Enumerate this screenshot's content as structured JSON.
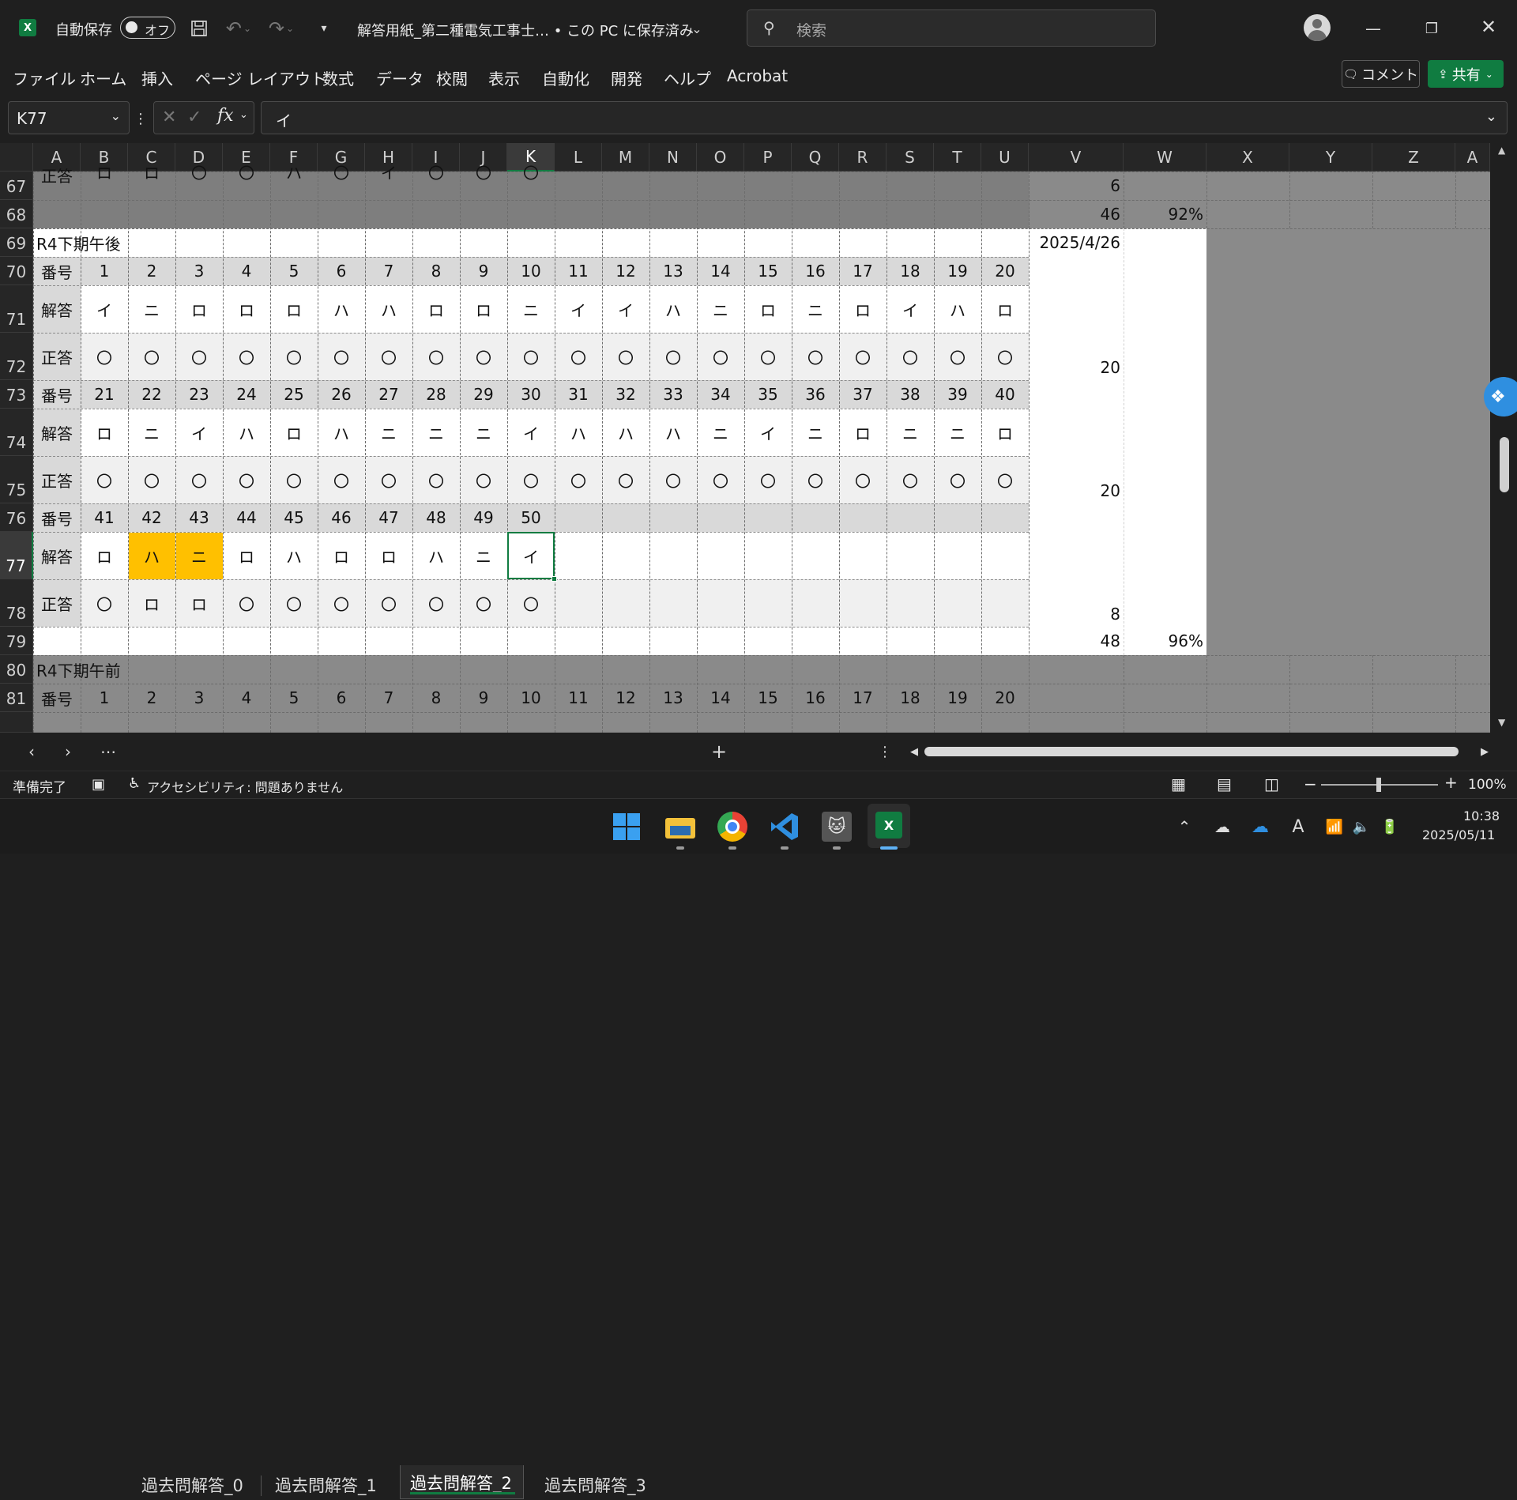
{
  "title": {
    "autosave_label": "自動保存",
    "autosave_state": "オフ",
    "filename": "解答用紙_第二種電気工事士… • この PC に保存済み",
    "search_placeholder": "検索"
  },
  "menu": [
    "ファイル",
    "ホーム",
    "挿入",
    "ページ レイアウト",
    "数式",
    "データ",
    "校閲",
    "表示",
    "自動化",
    "開発",
    "ヘルプ",
    "Acrobat"
  ],
  "comment_label": "コメント",
  "share_label": "共有",
  "namebox": "K77",
  "formula": "イ",
  "columns": [
    "A",
    "B",
    "C",
    "D",
    "E",
    "F",
    "G",
    "H",
    "I",
    "J",
    "K",
    "L",
    "M",
    "N",
    "O",
    "P",
    "Q",
    "R",
    "S",
    "T",
    "U",
    "V",
    "W",
    "X",
    "Y",
    "Z",
    "A"
  ],
  "row_numbers": [
    "67",
    "68",
    "69",
    "70",
    "71",
    "72",
    "73",
    "74",
    "75",
    "76",
    "77",
    "78",
    "79",
    "80",
    "81"
  ],
  "rows": {
    "r67": {
      "label": "正答",
      "cells": [
        "ロ",
        "ロ",
        "〇",
        "〇",
        "ハ",
        "〇",
        "イ",
        "〇",
        "〇",
        "〇",
        "",
        "",
        "",
        "",
        "",
        "",
        "",
        "",
        "",
        ""
      ],
      "v": "6",
      "w": ""
    },
    "r68": {
      "label": "",
      "cells": [],
      "v": "46",
      "w": "92%"
    },
    "r69": {
      "label": "R4下期午後",
      "v": "2025/4/26"
    },
    "r70": {
      "label": "番号",
      "cells": [
        "1",
        "2",
        "3",
        "4",
        "5",
        "6",
        "7",
        "8",
        "9",
        "10",
        "11",
        "12",
        "13",
        "14",
        "15",
        "16",
        "17",
        "18",
        "19",
        "20"
      ]
    },
    "r71": {
      "label": "解答",
      "cells": [
        "イ",
        "ニ",
        "ロ",
        "ロ",
        "ロ",
        "ハ",
        "ハ",
        "ロ",
        "ロ",
        "ニ",
        "イ",
        "イ",
        "ハ",
        "ニ",
        "ロ",
        "ニ",
        "ロ",
        "イ",
        "ハ",
        "ロ"
      ]
    },
    "r72": {
      "label": "正答",
      "cells": [
        "〇",
        "〇",
        "〇",
        "〇",
        "〇",
        "〇",
        "〇",
        "〇",
        "〇",
        "〇",
        "〇",
        "〇",
        "〇",
        "〇",
        "〇",
        "〇",
        "〇",
        "〇",
        "〇",
        "〇"
      ],
      "v": "20"
    },
    "r73": {
      "label": "番号",
      "cells": [
        "21",
        "22",
        "23",
        "24",
        "25",
        "26",
        "27",
        "28",
        "29",
        "30",
        "31",
        "32",
        "33",
        "34",
        "35",
        "36",
        "37",
        "38",
        "39",
        "40"
      ]
    },
    "r74": {
      "label": "解答",
      "cells": [
        "ロ",
        "ニ",
        "イ",
        "ハ",
        "ロ",
        "ハ",
        "ニ",
        "ニ",
        "ニ",
        "イ",
        "ハ",
        "ハ",
        "ハ",
        "ニ",
        "イ",
        "ニ",
        "ロ",
        "ニ",
        "ニ",
        "ロ"
      ]
    },
    "r75": {
      "label": "正答",
      "cells": [
        "〇",
        "〇",
        "〇",
        "〇",
        "〇",
        "〇",
        "〇",
        "〇",
        "〇",
        "〇",
        "〇",
        "〇",
        "〇",
        "〇",
        "〇",
        "〇",
        "〇",
        "〇",
        "〇",
        "〇"
      ],
      "v": "20"
    },
    "r76": {
      "label": "番号",
      "cells": [
        "41",
        "42",
        "43",
        "44",
        "45",
        "46",
        "47",
        "48",
        "49",
        "50",
        "",
        "",
        "",
        "",
        "",
        "",
        "",
        "",
        "",
        ""
      ]
    },
    "r77": {
      "label": "解答",
      "cells": [
        "ロ",
        "ハ",
        "ニ",
        "ロ",
        "ハ",
        "ロ",
        "ロ",
        "ハ",
        "ニ",
        "イ",
        "",
        "",
        "",
        "",
        "",
        "",
        "",
        "",
        "",
        ""
      ]
    },
    "r78": {
      "label": "正答",
      "cells": [
        "〇",
        "ロ",
        "ロ",
        "〇",
        "〇",
        "〇",
        "〇",
        "〇",
        "〇",
        "〇",
        "",
        "",
        "",
        "",
        "",
        "",
        "",
        "",
        "",
        ""
      ],
      "v": "8"
    },
    "r79": {
      "label": "",
      "v": "48",
      "w": "96%"
    },
    "r80": {
      "label": "R4下期午前"
    },
    "r81": {
      "label": "番号",
      "cells": [
        "1",
        "2",
        "3",
        "4",
        "5",
        "6",
        "7",
        "8",
        "9",
        "10",
        "11",
        "12",
        "13",
        "14",
        "15",
        "16",
        "17",
        "18",
        "19",
        "20"
      ]
    }
  },
  "colors": {
    "highlight": "#ffc000",
    "selection": "#107c41",
    "share": "#107c41"
  },
  "sheet_tabs": [
    "過去問解答_0",
    "過去問解答_1",
    "過去問解答_2",
    "過去問解答_3"
  ],
  "active_tab": "過去問解答_2",
  "status": {
    "ready": "準備完了",
    "accessibility": "アクセシビリティ: 問題ありません",
    "zoom": "100%"
  },
  "clock": {
    "time": "10:38",
    "date": "2025/05/11"
  }
}
